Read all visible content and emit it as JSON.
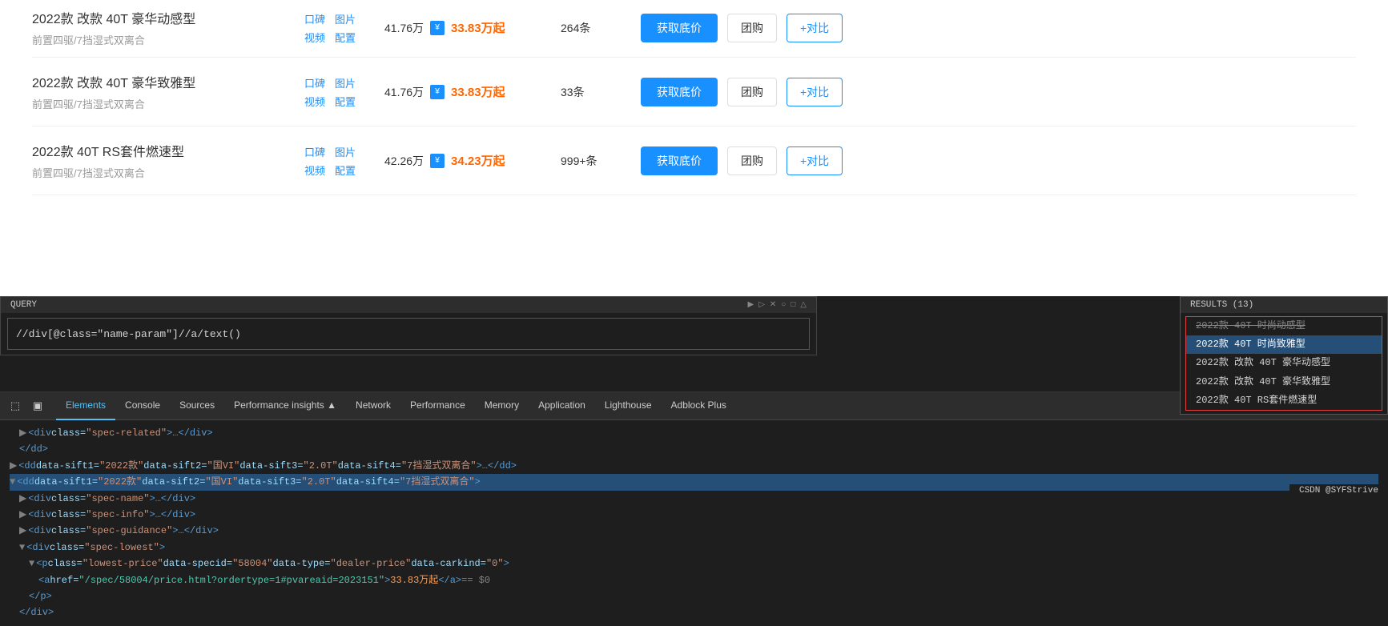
{
  "query": {
    "label": "QUERY",
    "value": "//div[@class=\"name-param\"]//a/text()"
  },
  "results": {
    "label": "RESULTS (13)",
    "items": [
      {
        "text": "2022款 40T 时尚动感型",
        "strikethrough": true,
        "highlight": false
      },
      {
        "text": "2022款 40T 时尚致雅型",
        "strikethrough": false,
        "highlight": true
      },
      {
        "text": "2022款 改款 40T 豪华动感型",
        "strikethrough": false,
        "highlight": false
      },
      {
        "text": "2022款 改款 40T 豪华致雅型",
        "strikethrough": false,
        "highlight": false
      },
      {
        "text": "2022款 40T RS套件燃速型",
        "strikethrough": false,
        "highlight": false
      }
    ]
  },
  "car_rows": [
    {
      "name": "2022款 改款 40T 豪华致雅型",
      "spec": "前置四驱/7挡湿式双离合",
      "guide_price": "41.76万",
      "dealer_price": "33.83万起",
      "count": "33条",
      "media1": [
        "口碑",
        "图片"
      ],
      "media2": [
        "视频",
        "配置"
      ]
    },
    {
      "name": "2022款 40T RS套件燃速型",
      "spec": "前置四驱/7挡湿式双离合",
      "guide_price": "42.26万",
      "dealer_price": "34.23万起",
      "count": "999+条",
      "media1": [
        "口碑",
        "图片"
      ],
      "media2": [
        "视频",
        "配置"
      ]
    }
  ],
  "partial_row": {
    "name": "2022款 改款 40T 豪华动感型",
    "spec": "前置四驱/7挡湿式双离合",
    "guide_price": "41.76万",
    "dealer_price": "33.83万起",
    "count": "264条"
  },
  "buttons": {
    "get_price": "获取底价",
    "group_buy": "团购",
    "compare": "+对比"
  },
  "devtools": {
    "tabs": [
      "Elements",
      "Console",
      "Sources",
      "Performance insights ▲",
      "Network",
      "Performance",
      "Memory",
      "Application",
      "Lighthouse",
      "Adblock Plus"
    ],
    "active_tab": "Elements"
  },
  "html_tree": [
    {
      "indent": 1,
      "content": "<div class=\"spec-related\">…</div>",
      "type": "tag"
    },
    {
      "indent": 1,
      "content": "</dd>",
      "type": "tag"
    },
    {
      "indent": 0,
      "content": "<dd data-sift1=\"2022款\" data-sift2=\"国VI\" data-sift3=\"2.0T\" data-sift4=\"7挡湿式双离合\">…</dd>",
      "type": "tag"
    },
    {
      "indent": 0,
      "content": "<dd data-sift1=\"2022款\" data-sift2=\"国VI\" data-sift3=\"2.0T\" data-sift4=\"7挡湿式双离合\">",
      "type": "tag",
      "selected": true
    },
    {
      "indent": 1,
      "content": "<div class=\"spec-name\">…</div>",
      "type": "tag"
    },
    {
      "indent": 1,
      "content": "<div class=\"spec-info\">…</div>",
      "type": "tag"
    },
    {
      "indent": 1,
      "content": "<div class=\"spec-guidance\">…</div>",
      "type": "tag"
    },
    {
      "indent": 1,
      "content": "<div class=\"spec-lowest\">",
      "type": "tag"
    },
    {
      "indent": 2,
      "content": "<p class=\"lowest-price\" data-specid=\"58004\" data-type=\"dealer-price\" data-carkind=\"0\">",
      "type": "tag"
    },
    {
      "indent": 3,
      "content": "<a href=\"/spec/58004/price.html?ordertype=1#pvareaid=2023151\">33.83万起</a>  == $0",
      "type": "link"
    },
    {
      "indent": 2,
      "content": "</p>",
      "type": "tag"
    },
    {
      "indent": 1,
      "content": "</div>",
      "type": "tag"
    }
  ],
  "status_bar": {
    "text": "CSDN @SYFStrive"
  }
}
